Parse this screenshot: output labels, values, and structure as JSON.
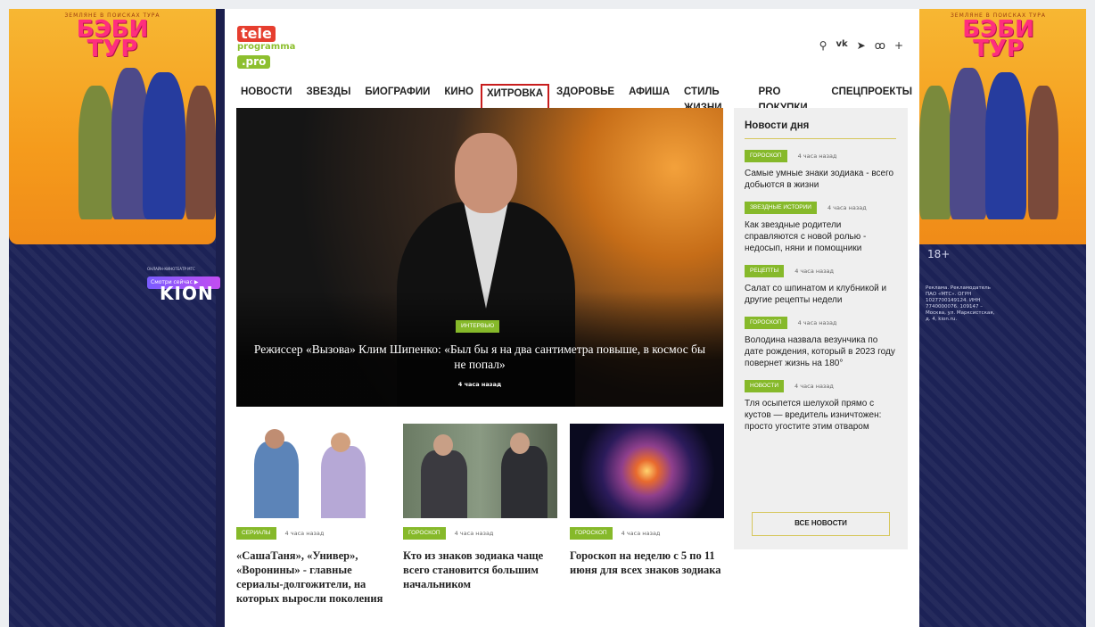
{
  "left_banner": {
    "kicker": "ЗЕМЛЯНЕ В ПОИСКАХ ТУРА",
    "title_line1": "БЭБИ",
    "title_line2": "ТУР",
    "brand": "KION",
    "brand_sub": "ОНЛАЙН-КИНОТЕАТР МТС",
    "cta": "Смотри сейчас ▶"
  },
  "right_banner": {
    "kicker": "ЗЕМЛЯНЕ В ПОИСКАХ ТУРА",
    "title_line1": "БЭБИ",
    "title_line2": "ТУР",
    "age": "18+",
    "legal": "Реклама. Рекламодатель ПАО «МТС». ОГРН 1027700149124. ИНН 7740000076. 109147 – Москва, ул. Марксистская, д. 4, kion.ru."
  },
  "logo": {
    "tele": "tele",
    "programma": "programma",
    "pro": ".pro"
  },
  "header_icons": [
    "search-icon",
    "vk-icon",
    "telegram-icon",
    "odnoklassniki-icon",
    "plus-icon"
  ],
  "icon_glyphs": {
    "search": "⚲",
    "vk": "vk",
    "telegram": "➤",
    "ok": "ꝏ",
    "plus": "+"
  },
  "nav": [
    "НОВОСТИ",
    "ЗВЕЗДЫ",
    "БИОГРАФИИ",
    "КИНО",
    "ХИТРОВКА",
    "ЗДОРОВЬЕ",
    "АФИША",
    "СТИЛЬ ЖИЗНИ",
    "PRO ПОКУПКИ",
    "СПЕЦПРОЕКТЫ"
  ],
  "nav_active": "ХИТРОВКА",
  "hero": {
    "tag": "ИНТЕРВЬЮ",
    "title": "Режиссер «Вызова» Клим Шипенко: «Был бы я на два сантиметра повыше, в космос бы не попал»",
    "time": "4 часа назад"
  },
  "cards": [
    {
      "tag": "СЕРИАЛЫ",
      "time": "4 часа назад",
      "title": "«СашаТаня», «Универ», «Воронины» - главные сериалы-долгожители, на которых выросли поколения"
    },
    {
      "tag": "ГОРОСКОП",
      "time": "4 часа назад",
      "title": "Кто из знаков зодиака чаще всего становится большим начальником"
    },
    {
      "tag": "ГОРОСКОП",
      "time": "4 часа назад",
      "title": "Гороскоп на неделю с 5 по 11 июня для всех знаков зодиака"
    }
  ],
  "news": {
    "heading": "Новости дня",
    "items": [
      {
        "tag": "ГОРОСКОП",
        "time": "4 часа назад",
        "text": "Самые умные знаки зодиака - всего добьются в жизни"
      },
      {
        "tag": "ЗВЕЗДНЫЕ ИСТОРИИ",
        "time": "4 часа назад",
        "text": "Как звездные родители справляются с новой ролью - недосып, няни и помощники"
      },
      {
        "tag": "РЕЦЕПТЫ",
        "time": "4 часа назад",
        "text": "Салат со шпинатом и клубникой и другие рецепты недели"
      },
      {
        "tag": "ГОРОСКОП",
        "time": "4 часа назад",
        "text": "Володина назвала везунчика по дате рождения, который в 2023 году повернет жизнь на 180°"
      },
      {
        "tag": "НОВОСТИ",
        "time": "4 часа назад",
        "text": "Тля осыпется шелухой прямо с кустов — вредитель изничтожен: просто угостите этим отваром"
      }
    ],
    "all_button": "ВСЕ НОВОСТИ"
  },
  "colors": {
    "accent_green": "#86b92a",
    "active_nav_border": "#c81d1d",
    "banner_bg": "#1c2256"
  }
}
